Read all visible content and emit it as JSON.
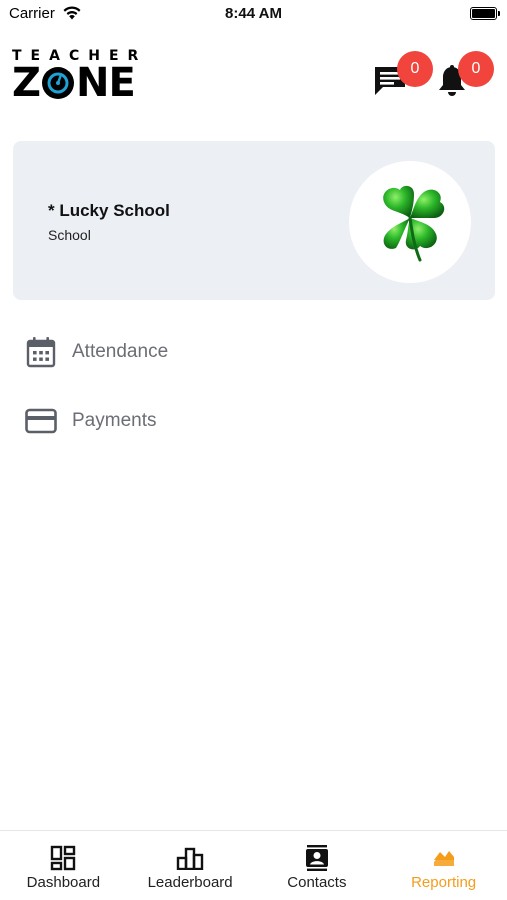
{
  "status_bar": {
    "carrier": "Carrier",
    "time": "8:44 AM"
  },
  "header": {
    "logo_top": "TEACHER",
    "logo_bottom_z": "Z",
    "logo_bottom_ne": "NE",
    "messages_count": "0",
    "notifications_count": "0",
    "badge_color": "#f0443d"
  },
  "school_card": {
    "name": "* Lucky School",
    "type": "School",
    "avatar_icon": "shamrock-icon"
  },
  "menu": {
    "items": [
      {
        "label": "Attendance",
        "icon": "calendar-icon"
      },
      {
        "label": "Payments",
        "icon": "credit-card-icon"
      }
    ]
  },
  "tab_bar": {
    "active_color": "#f59d1b",
    "tabs": [
      {
        "label": "Dashboard",
        "icon": "dashboard-icon"
      },
      {
        "label": "Leaderboard",
        "icon": "leaderboard-icon"
      },
      {
        "label": "Contacts",
        "icon": "contacts-icon"
      },
      {
        "label": "Reporting",
        "icon": "reporting-icon",
        "active": true
      }
    ]
  }
}
